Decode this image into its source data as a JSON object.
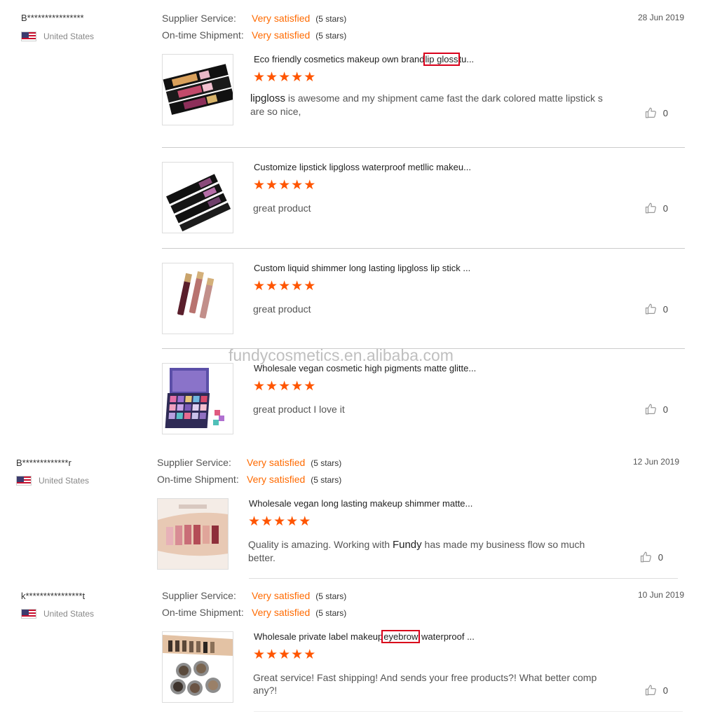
{
  "labels": {
    "supplier_service": "Supplier Service:",
    "ontime_shipment": "On-time Shipment:"
  },
  "watermark": "fundycosmetics.en.alibaba.com",
  "reviews": [
    {
      "user": "B****************",
      "country": "United States",
      "date": "28 Jun 2019",
      "supplier_value": "Very satisfied",
      "supplier_stars": "(5 stars)",
      "shipment_value": "Very satisfied",
      "shipment_stars": "(5 stars)",
      "items": [
        {
          "title_pre": "Eco friendly cosmetics makeup own brand",
          "title_hl": "lip gloss",
          "title_post": "tu...",
          "rating": 5,
          "comment_name": "lipgloss",
          "comment": " is awesome and my shipment came fast the dark colored matte lipstick s are so nice,",
          "likes": "0"
        },
        {
          "title": "Customize lipstick lipgloss waterproof metllic makeu...",
          "rating": 5,
          "comment": "great product",
          "likes": "0"
        },
        {
          "title": "Custom liquid shimmer long lasting lipgloss lip stick ...",
          "rating": 5,
          "comment": "great product",
          "likes": "0"
        },
        {
          "title": "Wholesale vegan cosmetic high pigments matte glitte...",
          "rating": 5,
          "comment": "great product I love it",
          "likes": "0"
        }
      ]
    },
    {
      "user": "B*************r",
      "country": "United States",
      "date": "12 Jun 2019",
      "supplier_value": "Very satisfied",
      "supplier_stars": "(5 stars)",
      "shipment_value": "Very satisfied",
      "shipment_stars": "(5 stars)",
      "items": [
        {
          "title": "Wholesale vegan long lasting makeup shimmer matte...",
          "rating": 5,
          "comment_pre": "Quality is amazing. Working with ",
          "comment_name": "Fundy",
          "comment_post": " has made my business flow so much better.",
          "likes": "0"
        }
      ]
    },
    {
      "user": "k****************t",
      "country": "United States",
      "date": "10 Jun 2019",
      "supplier_value": "Very satisfied",
      "supplier_stars": "(5 stars)",
      "shipment_value": "Very satisfied",
      "shipment_stars": "(5 stars)",
      "items": [
        {
          "title_pre": "Wholesale private label makeup",
          "title_hl": "eyebrow",
          "title_post": " waterproof ...",
          "rating": 5,
          "comment": "Great service! Fast shipping! And sends your free products?! What better comp any?!",
          "likes": "0"
        }
      ]
    }
  ],
  "colors": {
    "accent": "#ff6a00",
    "star": "#ff5500",
    "highlight_box": "#d9001b"
  },
  "icons": {
    "like": "thumbs-up-icon",
    "flag": "us-flag-icon",
    "star": "star-icon"
  }
}
